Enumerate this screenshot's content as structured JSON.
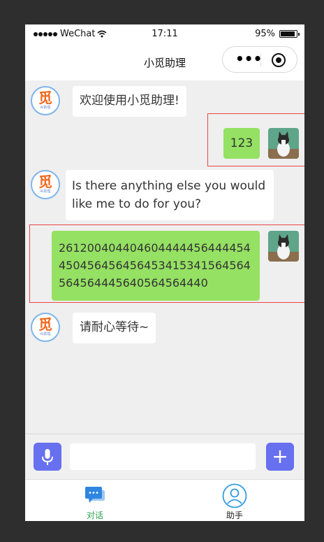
{
  "status_bar": {
    "carrier": "WeChat",
    "time": "17:11",
    "battery": "95%"
  },
  "nav": {
    "title": "小觅助理"
  },
  "avatar_ai": {
    "glyph": "觅",
    "caption": "AI助理"
  },
  "messages": [
    {
      "from": "assistant",
      "text": "欢迎使用小觅助理!"
    },
    {
      "from": "user",
      "text": "123"
    },
    {
      "from": "assistant",
      "text": "Is there anything else you would like me to do for you?"
    },
    {
      "from": "user",
      "text": "261200404404604444456444454450456456456453415341564564564564445640564564440"
    },
    {
      "from": "assistant",
      "text": "请耐心等待~"
    }
  ],
  "input": {
    "placeholder": "",
    "value": ""
  },
  "tabs": [
    {
      "label": "对话",
      "active": true
    },
    {
      "label": "助手",
      "active": false
    }
  ],
  "colors": {
    "user_bubble": "#95e163",
    "assistant_bubble": "#ffffff",
    "accent_button": "#6770ee",
    "active_tab": "#2ea44f"
  }
}
